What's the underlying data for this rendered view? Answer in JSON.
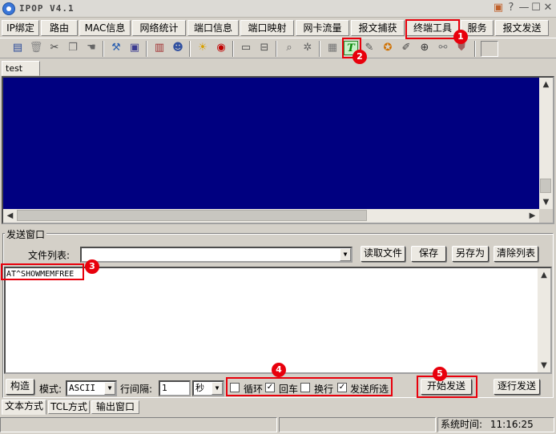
{
  "window": {
    "title": "IPOP V4.1",
    "help_glyph": "?",
    "min_glyph": "—",
    "max_glyph": "☐",
    "close_glyph": "✕"
  },
  "menu": [
    "IP绑定",
    "路由",
    "MAC信息",
    "网络统计",
    "端口信息",
    "端口映射",
    "网卡流量",
    "报文捕获",
    "终端工具",
    "服务",
    "报文发送"
  ],
  "toolbar_icons": [
    "computer-icon",
    "trash-icon",
    "cut-icon",
    "copy-icon",
    "hand-icon",
    "tools-icon",
    "monitor-icon",
    "books-icon",
    "people-icon",
    "sun-icon",
    "record-icon",
    "keyboard-icon",
    "zoom-icon",
    "gear-icon",
    "grid-icon",
    "terminal-icon",
    "pen-icon",
    "mask-icon",
    "pencil-icon",
    "magnifier-icon",
    "link-icon",
    "shield-icon"
  ],
  "doc_tab": "test",
  "send_window": {
    "group_label": "发送窗口",
    "file_list_label": "文件列表:",
    "file_list_value": "",
    "read_file": "读取文件",
    "save": "保存",
    "save_as": "另存为",
    "clear_list": "清除列表",
    "content": "AT^SHOWMEMFREE",
    "construct": "构造",
    "mode_label": "模式:",
    "mode_value": "ASCII",
    "interval_label": "行间隔:",
    "interval_value": "1",
    "unit_value": "秒",
    "loop_label": "循环",
    "loop_checked": false,
    "cr_label": "回车",
    "cr_checked": true,
    "newline_label": "换行",
    "newline_checked": false,
    "send_selected_label": "发送所选",
    "send_selected_checked": true,
    "start_send": "开始发送",
    "line_send": "逐行发送"
  },
  "bottom_tabs": [
    "文本方式",
    "TCL方式",
    "输出窗口"
  ],
  "status": {
    "time_label": "系统时间:",
    "time": "11:16:25"
  },
  "annotations": [
    "1",
    "2",
    "3",
    "4",
    "5"
  ],
  "colors": {
    "highlight": "#e8000c",
    "receive_bg": "#000080"
  }
}
